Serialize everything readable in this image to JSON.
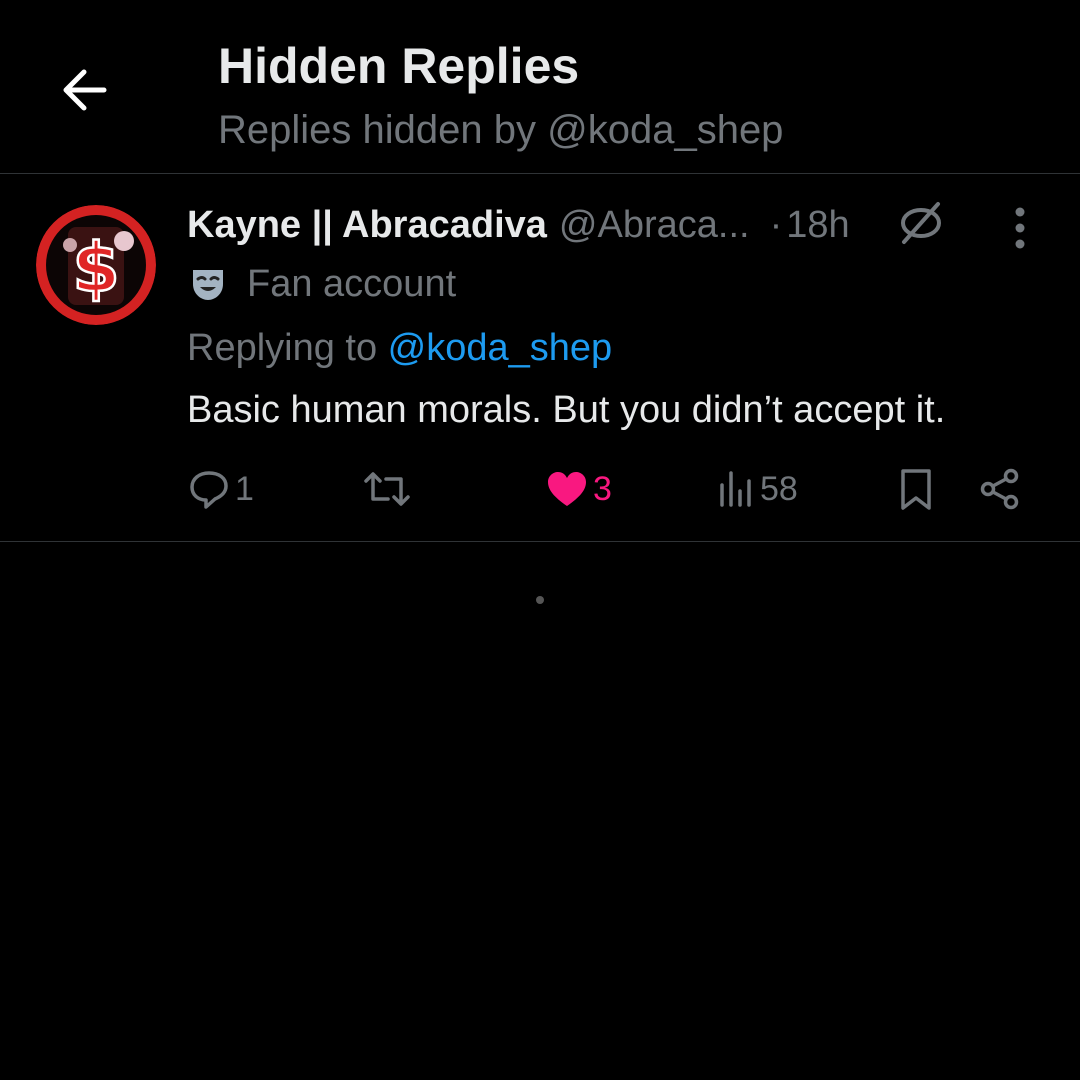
{
  "header": {
    "title": "Hidden Replies",
    "subtitle": "Replies hidden by @koda_shep",
    "back_icon": "arrow-left-icon"
  },
  "tweet": {
    "display_name": "Kayne || Abracadiva",
    "handle": "@Abraca...",
    "separator": "·",
    "timestamp": "18h",
    "label": "Fan account",
    "label_icon": "theater-mask-icon",
    "replying_prefix": "Replying to ",
    "replying_to": "@koda_shep",
    "text": "Basic human morals. But you didn’t accept it.",
    "avatar_symbol": "$",
    "actions": {
      "replies": "1",
      "retweets": "",
      "likes": "3",
      "views": "58"
    }
  },
  "colors": {
    "background": "#000000",
    "text_primary": "#e7e9ea",
    "text_secondary": "#71767b",
    "accent_blue": "#1d9bf0",
    "like_pink": "#f91880",
    "divider": "#2f3336"
  }
}
